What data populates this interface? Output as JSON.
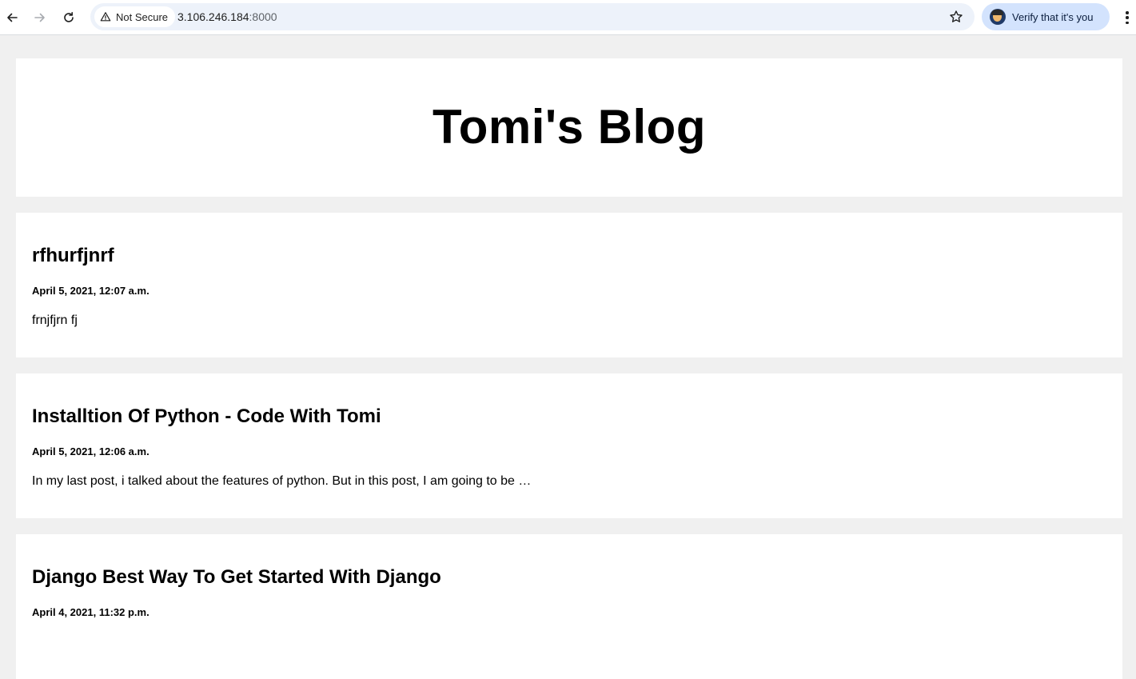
{
  "browser": {
    "security_label": "Not Secure",
    "url_host": "3.106.246.184",
    "url_port": ":8000",
    "verify_label": "Verify that it's you",
    "accent_color": "#d3e3fd"
  },
  "blog": {
    "title": "Tomi's Blog",
    "posts": [
      {
        "title": "rfhurfjnrf",
        "date": "April 5, 2021, 12:07 a.m.",
        "excerpt": "frnjfjrn fj"
      },
      {
        "title": "Installtion Of Python - Code With Tomi",
        "date": "April 5, 2021, 12:06 a.m.",
        "excerpt": "In my last post, i talked about the features of python. But in this post, I am going to be …"
      },
      {
        "title": "Django Best Way To Get Started With Django",
        "date": "April 4, 2021, 11:32 p.m.",
        "excerpt": ""
      }
    ]
  }
}
